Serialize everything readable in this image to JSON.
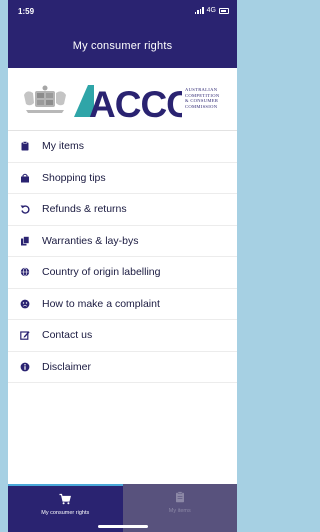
{
  "status": {
    "time": "1:59",
    "network": "4G"
  },
  "header": {
    "title": "My consumer rights"
  },
  "logo": {
    "wordmark": "ACCC",
    "org_lines": [
      "AUSTRALIAN",
      "COMPETITION",
      "& CONSUMER",
      "COMMISSION"
    ]
  },
  "menu": {
    "items": [
      {
        "label": "My items",
        "icon": "clipboard-icon"
      },
      {
        "label": "Shopping tips",
        "icon": "shopping-bag-icon"
      },
      {
        "label": "Refunds & returns",
        "icon": "refresh-icon"
      },
      {
        "label": "Warranties & lay-bys",
        "icon": "documents-icon"
      },
      {
        "label": "Country of origin labelling",
        "icon": "globe-icon"
      },
      {
        "label": "How to make a complaint",
        "icon": "frown-icon"
      },
      {
        "label": "Contact us",
        "icon": "edit-icon"
      },
      {
        "label": "Disclaimer",
        "icon": "info-icon"
      }
    ]
  },
  "tabbar": {
    "tabs": [
      {
        "label": "My consumer rights",
        "icon": "cart-icon",
        "active": true
      },
      {
        "label": "My items",
        "icon": "clipboard-icon",
        "active": false
      }
    ]
  },
  "colors": {
    "primary": "#2a2371",
    "accent": "#4aa8d8",
    "background": "#a6d0e3"
  }
}
